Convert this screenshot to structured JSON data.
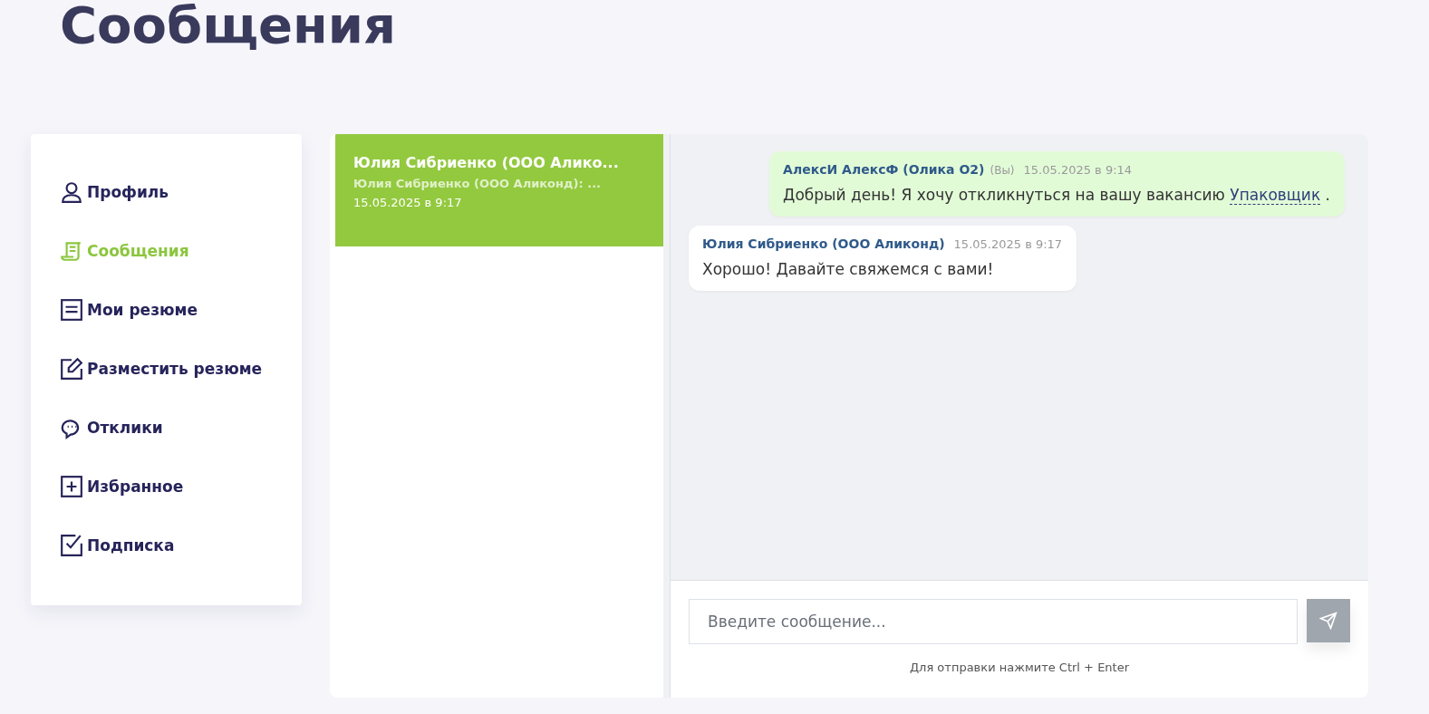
{
  "page_title": "Сообщения",
  "sidebar": {
    "items": [
      {
        "label": "Профиль",
        "selected": false
      },
      {
        "label": "Сообщения",
        "selected": true
      },
      {
        "label": "Мои резюме",
        "selected": false
      },
      {
        "label": "Разместить резюме",
        "selected": false
      },
      {
        "label": "Отклики",
        "selected": false
      },
      {
        "label": "Избранное",
        "selected": false
      },
      {
        "label": "Подписка",
        "selected": false
      }
    ]
  },
  "conversations": [
    {
      "title": "Юлия Сибриенко (ООО Алико...",
      "preview": "Юлия Сибриенко (ООО Аликонд): ...",
      "time": "15.05.2025 в 9:17",
      "selected": true
    }
  ],
  "messages": [
    {
      "kind": "own",
      "author": "АлексИ АлексФ (Олика О2)",
      "you_label": "(Вы)",
      "time": "15.05.2025 в 9:14",
      "text": "Добрый день! Я хочу откликнуться на вашу вакансию",
      "link": "Упаковщик",
      "text_after": "."
    },
    {
      "kind": "other",
      "author": "Юлия Сибриенко (ООО Аликонд)",
      "time": "15.05.2025 в 9:17",
      "text": "Хорошо! Давайте свяжемся с вами!"
    }
  ],
  "composer": {
    "placeholder": "Введите сообщение...",
    "hint": "Для отправки нажмите Ctrl + Enter"
  }
}
